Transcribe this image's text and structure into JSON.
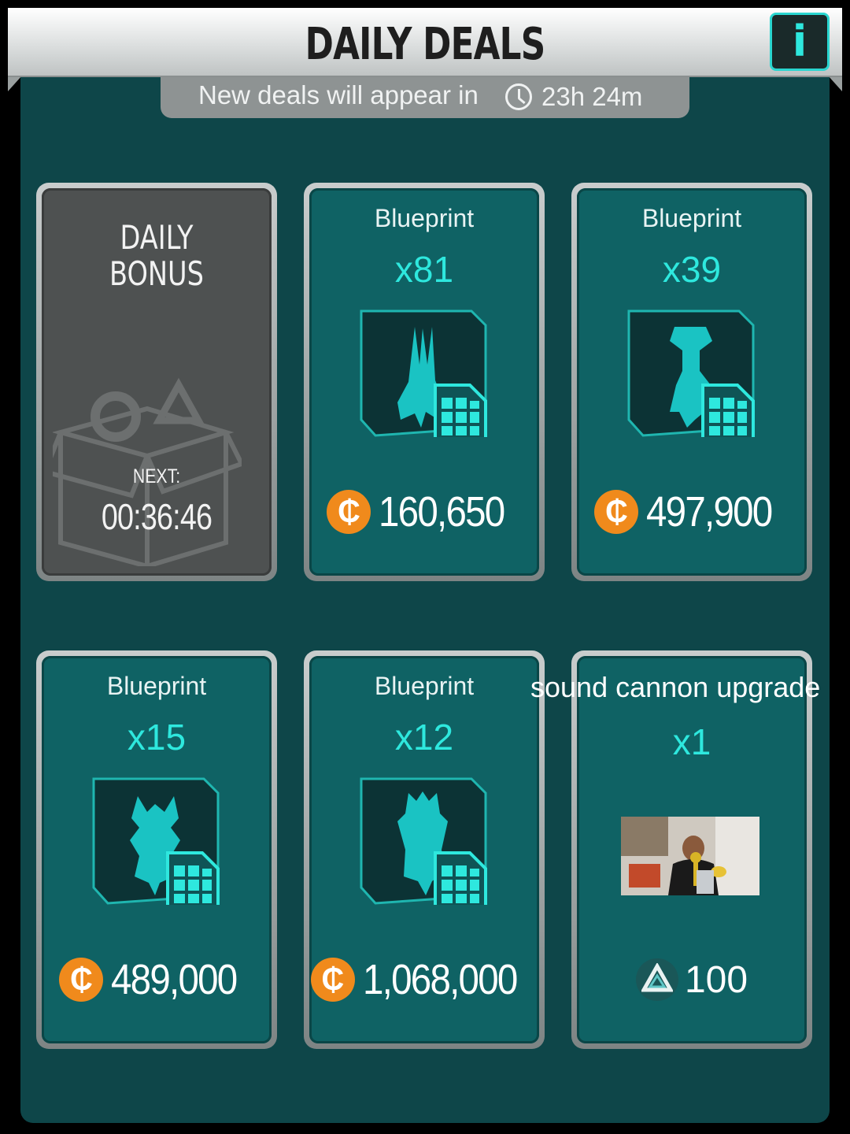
{
  "header": {
    "title": "DAILY DEALS",
    "info_label": "i"
  },
  "timer": {
    "prefix": "New deals will appear in",
    "value": "23h 24m"
  },
  "daily_bonus": {
    "title_line1": "DAILY",
    "title_line2": "BONUS",
    "next_label": "NEXT:",
    "next_time": "00:36:46"
  },
  "deals": [
    {
      "title": "Blueprint",
      "qty": "x81",
      "price": "160,650",
      "currency": "coin-icon"
    },
    {
      "title": "Blueprint",
      "qty": "x39",
      "price": "497,900",
      "currency": "coin-icon"
    },
    {
      "title": "Blueprint",
      "qty": "x15",
      "price": "489,000",
      "currency": "coin-icon"
    },
    {
      "title": "Blueprint",
      "qty": "x12",
      "price": "1,068,000",
      "currency": "coin-icon"
    },
    {
      "title": "sound cannon upgrade",
      "qty": "x1",
      "price": "100",
      "currency": "triangle-icon"
    }
  ],
  "icons": {
    "coin_symbol": "₵"
  },
  "colors": {
    "accent": "#2ee8de",
    "panel": "#0e4649",
    "card": "#0f6264",
    "coin": "#f08a1c"
  }
}
